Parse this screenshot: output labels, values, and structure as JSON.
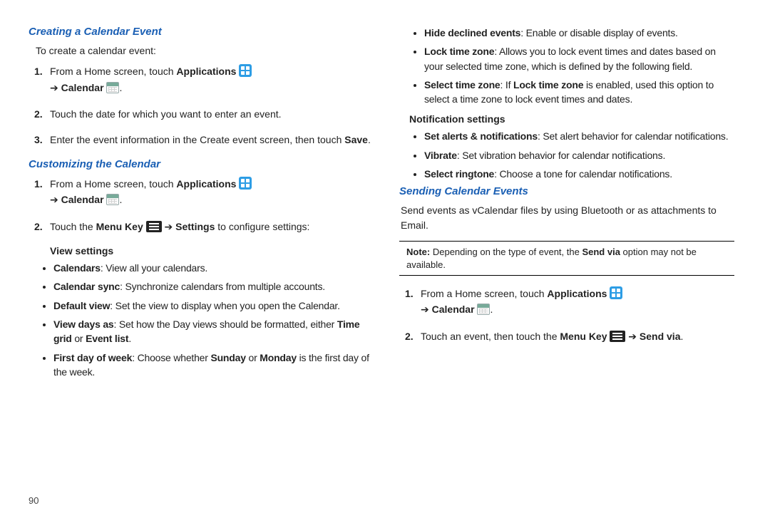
{
  "page_number": "90",
  "left": {
    "h1": "Creating a Calendar Event",
    "intro": "To create a calendar event:",
    "step1_a": "From a Home screen, touch ",
    "step1_app": "Applications",
    "arrow": "➔",
    "step1_cal": "Calendar",
    "period": ".",
    "step2": "Touch the date for which you want to enter an event.",
    "step3_a": "Enter the event information in the Create event screen, then touch ",
    "step3_save": "Save",
    "h2": "Customizing the Calendar",
    "c_step1_a": "From a Home screen, touch ",
    "c_step2_a": "Touch the ",
    "c_step2_menu": "Menu Key",
    "c_step2_b": " ",
    "c_step2_settings": "Settings",
    "c_step2_c": " to configure settings:",
    "view_settings_head": "View settings",
    "view": [
      {
        "b": "Calendars",
        "t": ": View all your calendars."
      },
      {
        "b": "Calendar sync",
        "t": ": Synchronize calendars from multiple accounts."
      },
      {
        "b": "Default view",
        "t": ": Set the view to display when you open the Calendar."
      },
      {
        "b": "View days as",
        "t": ": Set how the Day views should be formatted, either ",
        "b2": "Time grid",
        "mid": " or ",
        "b3": "Event list",
        "end": "."
      },
      {
        "b": "First day of week",
        "t": ": Choose whether ",
        "b2": "Sunday",
        "mid": " or ",
        "b3": "Monday",
        "end": " is the first day of the week."
      }
    ]
  },
  "right": {
    "top": [
      {
        "b": "Hide declined events",
        "t": ": Enable or disable display of events."
      },
      {
        "b": "Lock time zone",
        "t": ": Allows you to lock event times and dates based on your selected time zone, which is defined by the following field."
      },
      {
        "b": "Select time zone",
        "t": ": If ",
        "b2": "Lock time zone",
        "mid": " is enabled, used this option to select a time zone to lock event times and dates."
      }
    ],
    "notif_head": "Notification settings",
    "notif": [
      {
        "b": "Set alerts & notifications",
        "t": ": Set alert behavior for calendar notifications."
      },
      {
        "b": "Vibrate",
        "t": ": Set vibration behavior for calendar notifications."
      },
      {
        "b": "Select ringtone",
        "t": ": Choose a tone for calendar notifications."
      }
    ],
    "h3": "Sending Calendar Events",
    "send_para": "Send events as vCalendar files by using Bluetooth or as attachments to Email.",
    "note_b": "Note: ",
    "note_a": "Depending on the type of event, the ",
    "note_sv": "Send via",
    "note_c": " option may not be available.",
    "s_step1_a": "From a Home screen, touch ",
    "s_step2_a": "Touch an event, then touch the ",
    "s_step2_menu": "Menu Key",
    "s_step2_sv": "Send via"
  }
}
